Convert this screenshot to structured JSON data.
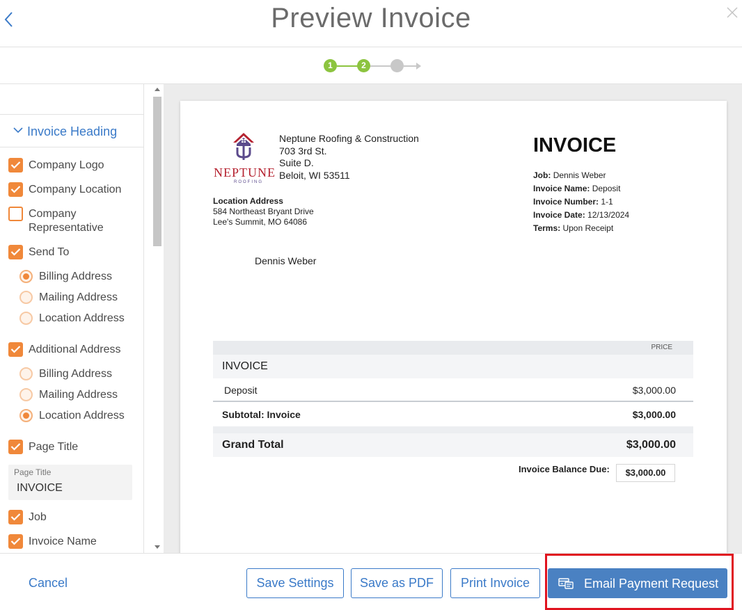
{
  "header": {
    "title": "Preview Invoice",
    "back_icon": "chevron-left-icon",
    "close_icon": "close-icon"
  },
  "stepper": {
    "steps": [
      "1",
      "2",
      ""
    ],
    "current_step": 2,
    "total_steps": 3,
    "color_done": "#8cc43f",
    "color_todo": "#c8c8c8"
  },
  "settings": {
    "section_title": "Invoice Heading",
    "company_logo": {
      "label": "Company Logo",
      "checked": true
    },
    "company_location": {
      "label": "Company Location",
      "checked": true
    },
    "company_rep": {
      "label": "Company Representative",
      "checked": false
    },
    "send_to": {
      "label": "Send To",
      "checked": true,
      "options": [
        "Billing Address",
        "Mailing Address",
        "Location Address"
      ],
      "selected": "Billing Address"
    },
    "additional_address": {
      "label": "Additional Address",
      "checked": true,
      "options": [
        "Billing Address",
        "Mailing Address",
        "Location Address"
      ],
      "selected": "Location Address"
    },
    "page_title": {
      "label": "Page Title",
      "checked": true,
      "field_label": "Page Title",
      "field_value": "INVOICE"
    },
    "job": {
      "label": "Job",
      "checked": true
    },
    "invoice_name": {
      "label": "Invoice Name",
      "checked": true
    },
    "accent_color": "#f0883a"
  },
  "invoice": {
    "logo_word": "NEPTUNE",
    "logo_sub": "ROOFING",
    "company_name": "Neptune Roofing & Construction",
    "address_line1": "703 3rd St.",
    "address_line2": "Suite D.",
    "address_line3": "Beloit, WI 53511",
    "location_label": "Location Address",
    "location_line1": "584 Northeast Bryant Drive",
    "location_line2": "Lee's Summit, MO 64086",
    "recipient": "Dennis Weber",
    "title": "INVOICE",
    "job_label": "Job:",
    "job_value": "Dennis Weber",
    "name_label": "Invoice Name:",
    "name_value": "Deposit",
    "number_label": "Invoice Number:",
    "number_value": "1-1",
    "date_label": "Invoice Date:",
    "date_value": "12/13/2024",
    "terms_label": "Terms:",
    "terms_value": "Upon Receipt",
    "price_header": "PRICE",
    "section_name": "INVOICE",
    "item_name": "Deposit",
    "item_price": "$3,000.00",
    "subtotal_label": "Subtotal: Invoice",
    "subtotal_value": "$3,000.00",
    "grand_total_label": "Grand Total",
    "grand_total_value": "$3,000.00",
    "balance_label": "Invoice Balance Due:",
    "balance_value": "$3,000.00"
  },
  "footer": {
    "cancel": "Cancel",
    "save_settings": "Save Settings",
    "save_pdf": "Save as PDF",
    "print": "Print Invoice",
    "email": "Email Payment Request",
    "email_icon": "payment-card-icon",
    "primary_color": "#4a81c2",
    "highlight_color": "#e0131f"
  }
}
